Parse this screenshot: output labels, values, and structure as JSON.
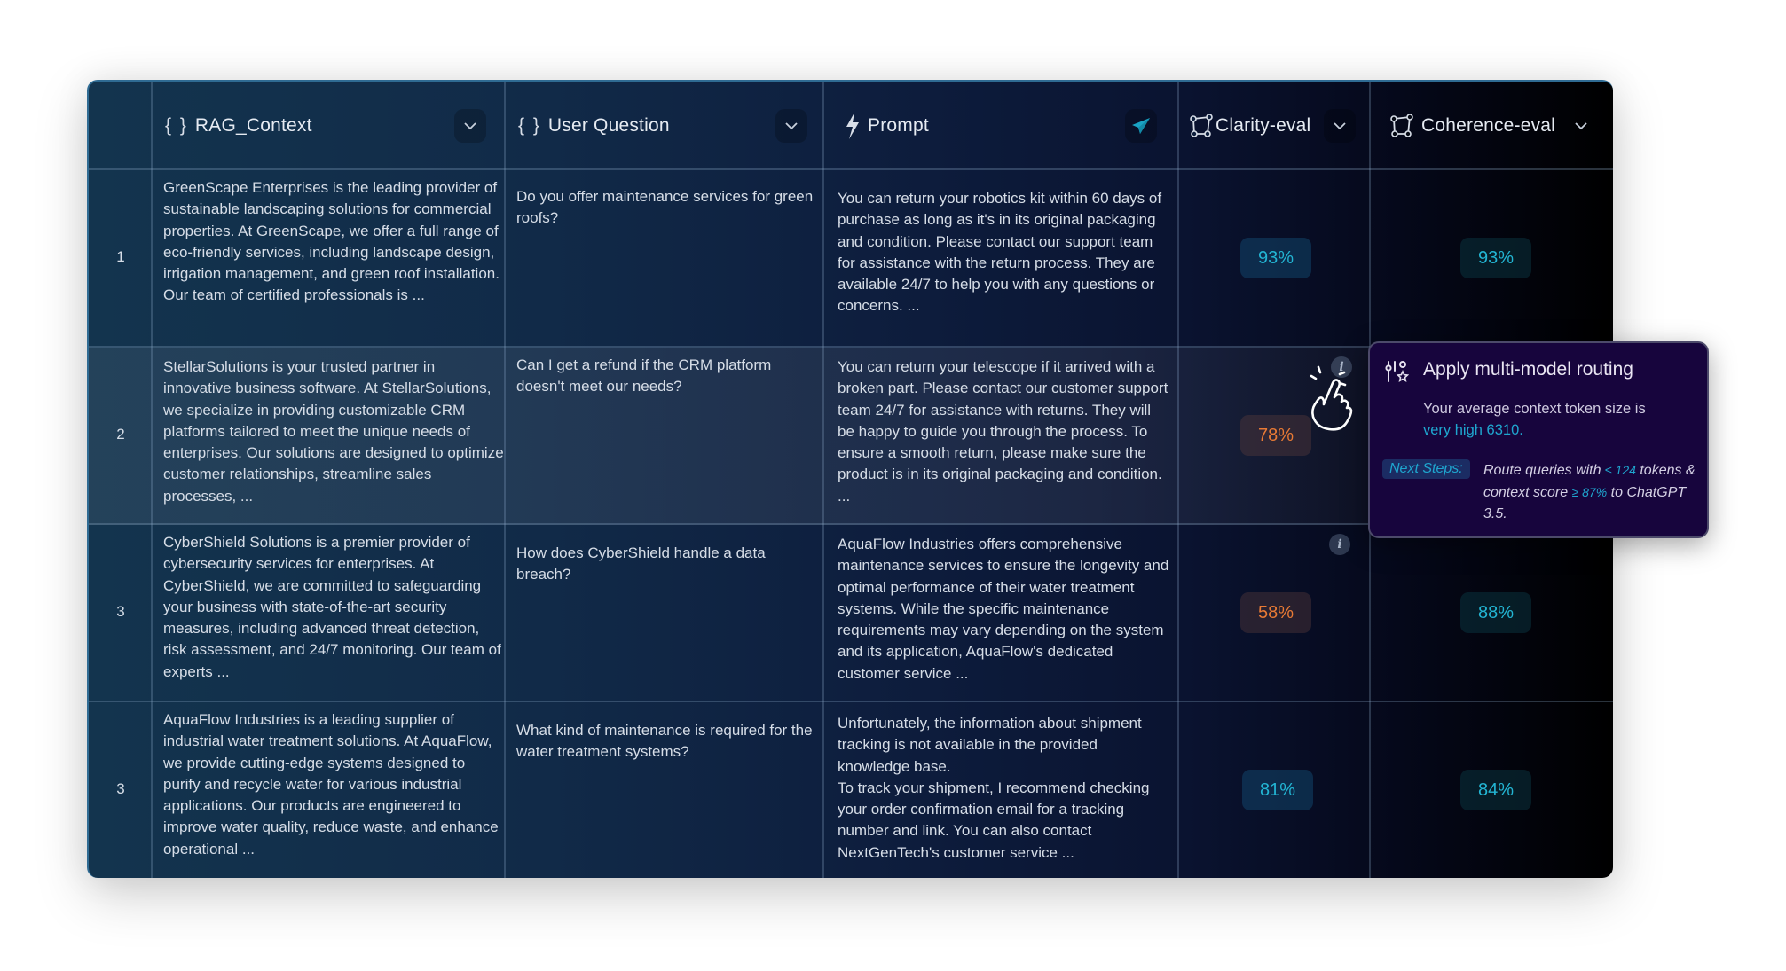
{
  "table": {
    "columns": [
      {
        "id": "index",
        "label": ""
      },
      {
        "id": "rag_context",
        "label": "RAG_Context",
        "icon": "braces-icon",
        "prefix": "{ }",
        "has_dropdown": true
      },
      {
        "id": "user_question",
        "label": "User Question",
        "icon": "braces-icon",
        "prefix": "{ }",
        "has_dropdown": true
      },
      {
        "id": "prompt",
        "label": "Prompt",
        "icon": "lightning-icon",
        "action_icon": "send-icon"
      },
      {
        "id": "clarity_eval",
        "label": "Clarity-eval",
        "icon": "polygon-nodes-icon",
        "has_dropdown": true
      },
      {
        "id": "coherence_eval",
        "label": "Coherence-eval",
        "icon": "polygon-nodes-icon",
        "has_dropdown": true
      }
    ],
    "rows": [
      {
        "index": "1",
        "rag_context": "GreenScape Enterprises is the leading provider of sustainable landscaping solutions for commercial properties. At GreenScape, we offer a full range of eco-friendly services, including landscape design, irrigation management, and green roof installation. Our team of certified professionals is ...",
        "user_question": "Do you offer maintenance services for green roofs?",
        "prompt": "You can return your robotics kit within 60 days of purchase as long as it's in its original packaging and condition. Please contact our support team for assistance with the return process. They are available 24/7 to help you with any questions or concerns. ...",
        "clarity": "93%",
        "clarity_status": "good",
        "coherence": "93%",
        "coherence_status": "good"
      },
      {
        "index": "2",
        "rag_context": "StellarSolutions is your trusted partner in innovative business software. At StellarSolutions, we specialize in providing customizable CRM platforms tailored to meet the unique needs of enterprises. Our solutions are designed to optimize customer relationships, streamline sales processes, ...",
        "user_question": "Can I get a refund if the CRM platform doesn't meet our needs?",
        "prompt": "You can return your telescope if it arrived with a broken part. Please contact our customer support team 24/7 for assistance with returns. They will be happy to guide you through the process. To ensure a smooth return, please make sure the product is in its original packaging and condition. ...",
        "clarity": "78%",
        "clarity_status": "warning",
        "coherence": "",
        "coherence_status": ""
      },
      {
        "index": "3",
        "rag_context": "CyberShield Solutions is a premier provider of cybersecurity services for enterprises. At CyberShield, we are committed to safeguarding your business with state-of-the-art security measures, including advanced threat detection, risk assessment, and 24/7 monitoring. Our team of experts ...",
        "user_question": "How does CyberShield handle a data breach?",
        "prompt": "AquaFlow Industries offers comprehensive maintenance services to ensure the longevity and optimal performance of their water treatment systems. While the specific maintenance requirements may vary depending on the system and its application, AquaFlow's dedicated customer service ...",
        "clarity": "58%",
        "clarity_status": "warning",
        "coherence": "88%",
        "coherence_status": "good"
      },
      {
        "index": "3",
        "rag_context": "AquaFlow Industries is a leading supplier of industrial water treatment solutions. At AquaFlow, we provide cutting-edge systems designed to purify and recycle water for various industrial applications. Our products are engineered to improve water quality, reduce waste, and enhance operational ...",
        "user_question": "What kind of maintenance is required for the water treatment systems?",
        "prompt_lines": [
          "Unfortunately, the information about shipment tracking is not available in the provided knowledge base.",
          "To track your shipment, I recommend checking your order confirmation email for a tracking number and link. You can also contact NextGenTech's customer service ..."
        ],
        "clarity": "81%",
        "clarity_status": "good",
        "coherence": "84%",
        "coherence_status": "good"
      }
    ]
  },
  "tooltip": {
    "icon": "sliders-star-icon",
    "title": "Apply multi-model routing",
    "body_prefix": "Your average context token size is",
    "body_highlight": "very high 6310.",
    "next_steps_label": "Next Steps:",
    "steps_part1": "Route queries with",
    "steps_hl1": "≤ 124",
    "steps_part2": "tokens & context score",
    "steps_hl2": "≥  87%",
    "steps_part3": "to ChatGPT 3.5."
  },
  "colors": {
    "accent_cyan": "#23b5d3",
    "warning_orange": "#e87a35",
    "tooltip_bg": "#17053d",
    "telegram_blue": "#1aa3c4"
  }
}
